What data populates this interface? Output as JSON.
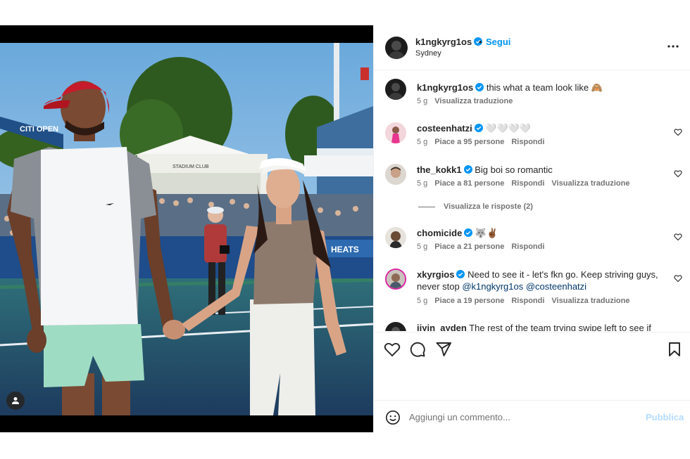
{
  "post": {
    "username": "k1ngkyrg1os",
    "dot": "•",
    "follow_label": "Segui",
    "location": "Sydney",
    "more_icon": "more-horizontal-icon"
  },
  "caption": {
    "username": "k1ngkyrg1os",
    "text": "this what a team look like 🙈",
    "time": "5 g",
    "translate": "Visualizza traduzione"
  },
  "comments": [
    {
      "username": "costeenhatzi",
      "text": "🤍🤍🤍🤍",
      "time": "5 g",
      "likes": "Piace a 95 persone",
      "reply": "Rispondi",
      "translate": ""
    },
    {
      "username": "the_kokk1",
      "text": "Big boi so romantic",
      "time": "5 g",
      "likes": "Piace a 81 persone",
      "reply": "Rispondi",
      "translate": "Visualizza traduzione"
    },
    {
      "username": "chomicide",
      "text": "🐺✌🏾",
      "time": "5 g",
      "likes": "Piace a 21 persone",
      "reply": "Rispondi",
      "translate": ""
    },
    {
      "username": "xkyrgios",
      "text": "Need to see it - let's fkn go. Keep striving guys, never stop",
      "mention1": "@k1ngkyrg1os",
      "mention2": "@costeenhatzi",
      "time": "5 g",
      "likes": "Piace a 19 persone",
      "reply": "Rispondi",
      "translate": "Visualizza traduzione"
    },
    {
      "username": "jiyin_ayden",
      "text": "The rest of the team trying swipe left to see if"
    }
  ],
  "view_replies": "Visualizza le risposte (2)",
  "add_comment": {
    "placeholder": "Aggiungi un commento...",
    "publish_label": "Pubblica"
  },
  "photo": {
    "banner_text": "CITI OPEN",
    "club_sign": "STADIUM CLUB",
    "sponsor_text": "HEATS"
  },
  "colors": {
    "link_blue": "#0095f6",
    "publish_disabled": "#b3dbff",
    "verified_blue": "#0095f6",
    "muted_text": "#737373"
  }
}
